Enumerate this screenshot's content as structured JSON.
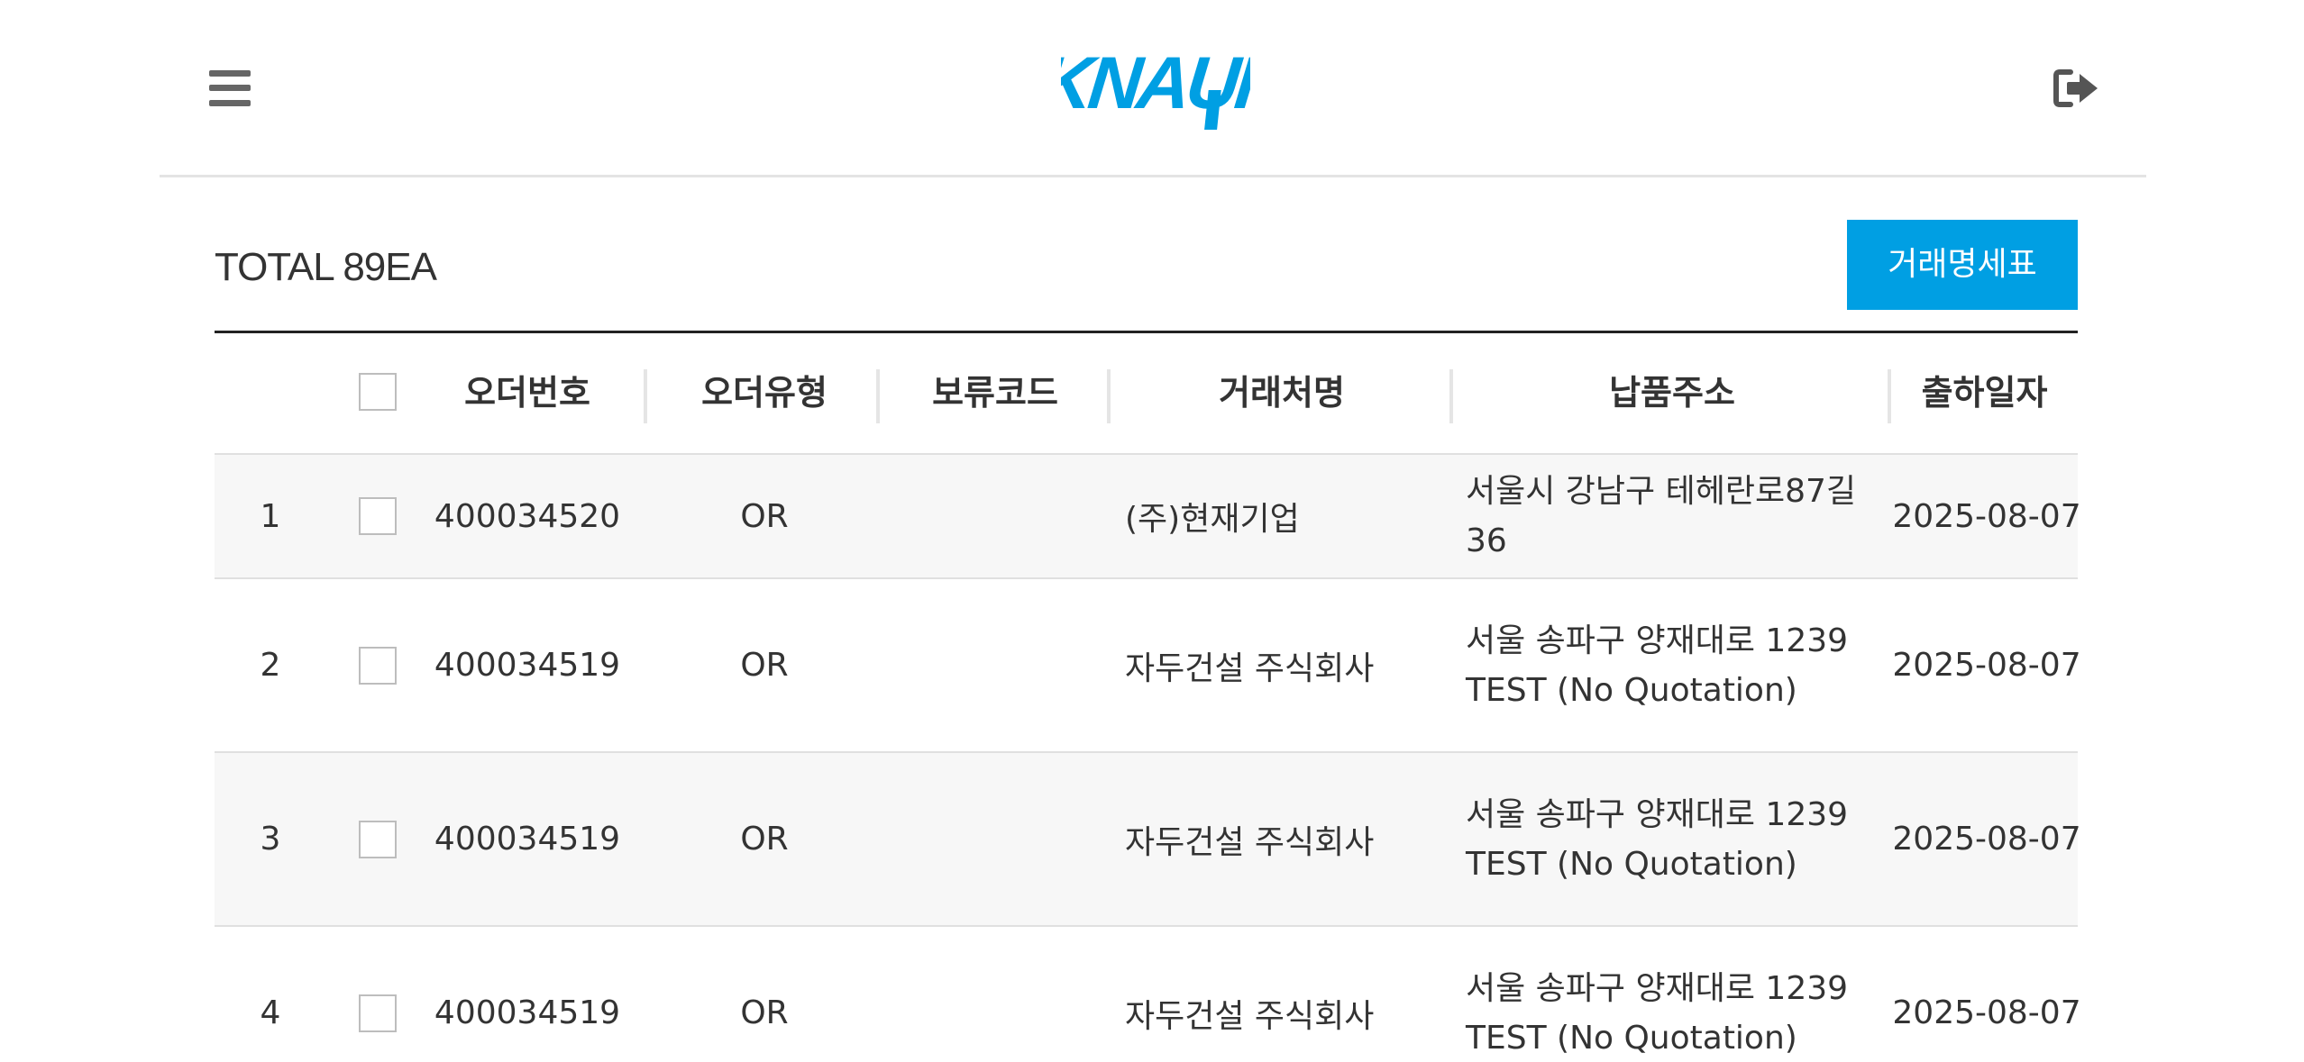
{
  "header": {
    "brand": "KNAUF",
    "brand_color": "#009fe3",
    "menu_icon": "hamburger-menu-icon",
    "logout_icon": "sign-out-icon"
  },
  "toolbar": {
    "total_label": "TOTAL 89EA",
    "statement_button_label": "거래명세표",
    "accent_color": "#009fe3"
  },
  "table": {
    "columns": [
      "오더번호",
      "오더유형",
      "보류코드",
      "거래처명",
      "납품주소",
      "출하일자"
    ],
    "rows": [
      {
        "no": "1",
        "order_no": "400034520",
        "order_type": "OR",
        "hold_code": "",
        "customer": "(주)현재기업",
        "address": "서울시 강남구 테헤란로87길 36",
        "ship_date": "2025-08-07"
      },
      {
        "no": "2",
        "order_no": "400034519",
        "order_type": "OR",
        "hold_code": "",
        "customer": "자두건설 주식회사",
        "address": "서울 송파구 양재대로 1239 TEST (No Quotation)",
        "ship_date": "2025-08-07"
      },
      {
        "no": "3",
        "order_no": "400034519",
        "order_type": "OR",
        "hold_code": "",
        "customer": "자두건설 주식회사",
        "address": "서울 송파구 양재대로 1239 TEST (No Quotation)",
        "ship_date": "2025-08-07"
      },
      {
        "no": "4",
        "order_no": "400034519",
        "order_type": "OR",
        "hold_code": "",
        "customer": "자두건설 주식회사",
        "address": "서울 송파구 양재대로 1239 TEST (No Quotation)",
        "ship_date": "2025-08-07"
      }
    ]
  }
}
